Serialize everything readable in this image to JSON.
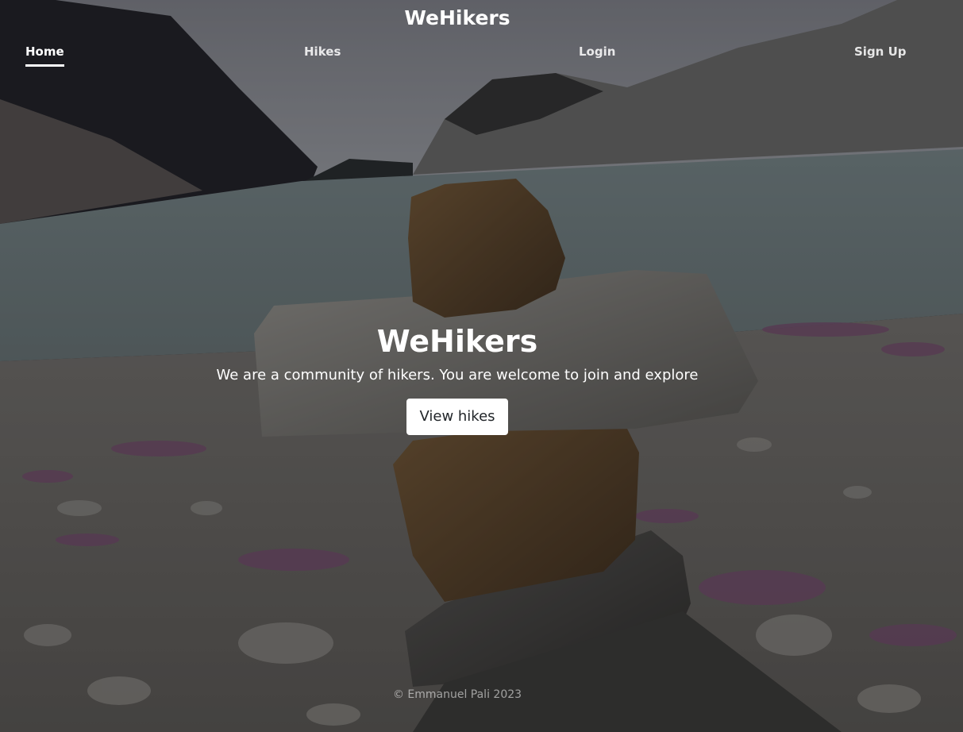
{
  "header": {
    "brand": "WeHikers",
    "nav": [
      {
        "label": "Home",
        "active": true
      },
      {
        "label": "Hikes",
        "active": false
      },
      {
        "label": "Login",
        "active": false
      },
      {
        "label": "Sign Up",
        "active": false
      }
    ]
  },
  "hero": {
    "title": "WeHikers",
    "subtitle": "We are a community of hikers. You are welcome to join and explore",
    "button_label": "View hikes"
  },
  "footer": {
    "text": "© Emmanuel Pali 2023"
  }
}
